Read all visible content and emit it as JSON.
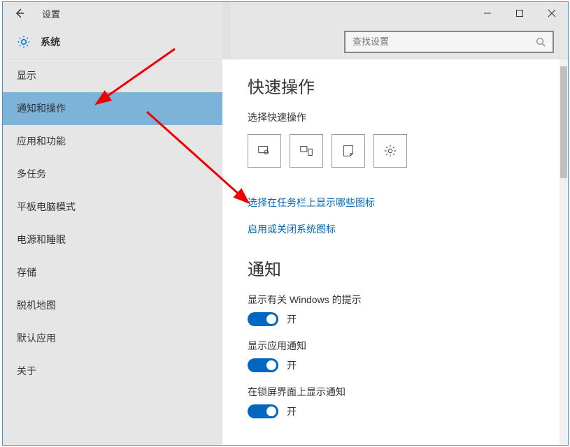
{
  "titlebar": {
    "title": "设置"
  },
  "subheader": {
    "title": "系统"
  },
  "search": {
    "placeholder": "查找设置"
  },
  "sidebar": {
    "items": [
      {
        "label": "显示",
        "selected": false
      },
      {
        "label": "通知和操作",
        "selected": true
      },
      {
        "label": "应用和功能",
        "selected": false
      },
      {
        "label": "多任务",
        "selected": false
      },
      {
        "label": "平板电脑模式",
        "selected": false
      },
      {
        "label": "电源和睡眠",
        "selected": false
      },
      {
        "label": "存储",
        "selected": false
      },
      {
        "label": "脱机地图",
        "selected": false
      },
      {
        "label": "默认应用",
        "selected": false
      },
      {
        "label": "关于",
        "selected": false
      }
    ]
  },
  "content": {
    "quick_actions_title": "快速操作",
    "quick_actions_subtitle": "选择快速操作",
    "link_taskbar_icons": "选择在任务栏上显示哪些图标",
    "link_system_icons": "启用或关闭系统图标",
    "notifications_title": "通知",
    "notif_items": [
      {
        "label": "显示有关 Windows 的提示",
        "state": "开"
      },
      {
        "label": "显示应用通知",
        "state": "开"
      },
      {
        "label": "在锁屏界面上显示通知",
        "state": "开"
      }
    ]
  }
}
